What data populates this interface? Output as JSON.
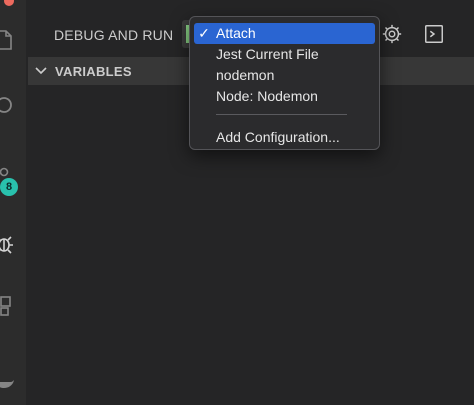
{
  "panel": {
    "title": "DEBUG AND RUN",
    "selected_config": "Attach"
  },
  "variables_section": {
    "title": "VARIABLES",
    "expanded": true
  },
  "activity_bar": {
    "badge_count": "8",
    "icons": [
      "files-icon",
      "search-icon",
      "source-control-icon",
      "debug-icon",
      "extensions-icon",
      "docker-icon"
    ]
  },
  "toolbar": {
    "icons": [
      "gear-icon",
      "terminal-icon"
    ]
  },
  "dropdown": {
    "options": [
      {
        "label": "Attach",
        "checked": true,
        "check_glyph": "✓"
      },
      {
        "label": "Jest Current File",
        "checked": false,
        "check_glyph": ""
      },
      {
        "label": "nodemon",
        "checked": false,
        "check_glyph": ""
      },
      {
        "label": "Node: Nodemon",
        "checked": false,
        "check_glyph": ""
      }
    ],
    "add_configuration": "Add Configuration..."
  },
  "colors": {
    "accent": "#2a65d2",
    "run_green": "#89d185",
    "badge": "#29c1ad"
  }
}
